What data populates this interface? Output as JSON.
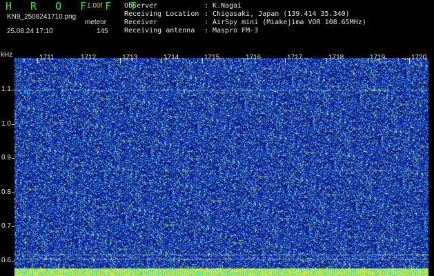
{
  "header": {
    "title": "HROFFT",
    "version": "1.00f",
    "filename": "KN9_2508241710.png",
    "mode": "meteor",
    "datetime": "25.08.24 17:10",
    "count": "145"
  },
  "station_info": [
    {
      "label": "Observer",
      "value": "K.Nagai"
    },
    {
      "label": "Receiving Location",
      "value": "Chigasaki, Japan (139.414 35.340)"
    },
    {
      "label": "Receiver",
      "value": "AirSpy mini (Miakejima VOR 108.65MHz)"
    },
    {
      "label": "Receiving antenna",
      "value": "Maspro FM-3"
    }
  ],
  "spectrogram": {
    "y_unit": "kHz",
    "y_ticks": [
      "1.1",
      "1.0",
      "0.9",
      "0.8",
      "0.7",
      "0.6"
    ],
    "time_ticks": [
      "1711",
      "1712",
      "1713",
      "1714",
      "1715",
      "1716",
      "1717",
      "1718",
      "1719",
      "1720"
    ],
    "colors": {
      "background": "#1328a8",
      "signal": "#29e0e0",
      "noise_hot": "#e8e850"
    }
  }
}
